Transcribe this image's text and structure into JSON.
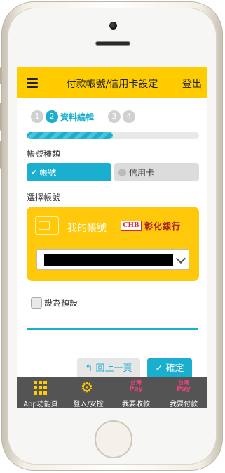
{
  "header": {
    "title": "付款帳號/信用卡設定",
    "logout_label": "登出"
  },
  "steps": [
    {
      "num": "1",
      "label": ""
    },
    {
      "num": "2",
      "label": "資料編輯"
    },
    {
      "num": "3",
      "label": ""
    },
    {
      "num": "4",
      "label": ""
    }
  ],
  "progress": {
    "fraction": 0.5
  },
  "account_type": {
    "label": "帳號種類",
    "options": [
      "帳號",
      "信用卡"
    ],
    "selected": "帳號"
  },
  "account_select": {
    "label": "選擇帳號",
    "card_title": "我的帳號",
    "bank_logo_text": "CHB",
    "bank_name": "彰化銀行"
  },
  "default_checkbox": {
    "label": "設為預設",
    "checked": false
  },
  "buttons": {
    "back": "↰ 回上一頁",
    "confirm": "✓ 確定"
  },
  "tabbar": [
    {
      "label": "App功能頁",
      "icon": "grid-icon"
    },
    {
      "label": "登入/安控",
      "icon": "gear-icon"
    },
    {
      "label": "我要收款",
      "icon": "taiwan-pay-icon",
      "icon_text": [
        "台灣",
        "Pay"
      ]
    },
    {
      "label": "我要付款",
      "icon": "taiwan-pay-icon",
      "icon_text": [
        "台灣",
        "Pay"
      ]
    }
  ],
  "colors": {
    "header": "#ffcc00",
    "accent": "#1aaecf",
    "card": "#ffc80a",
    "tabbar": "#545454",
    "pay": "#e8437a"
  }
}
